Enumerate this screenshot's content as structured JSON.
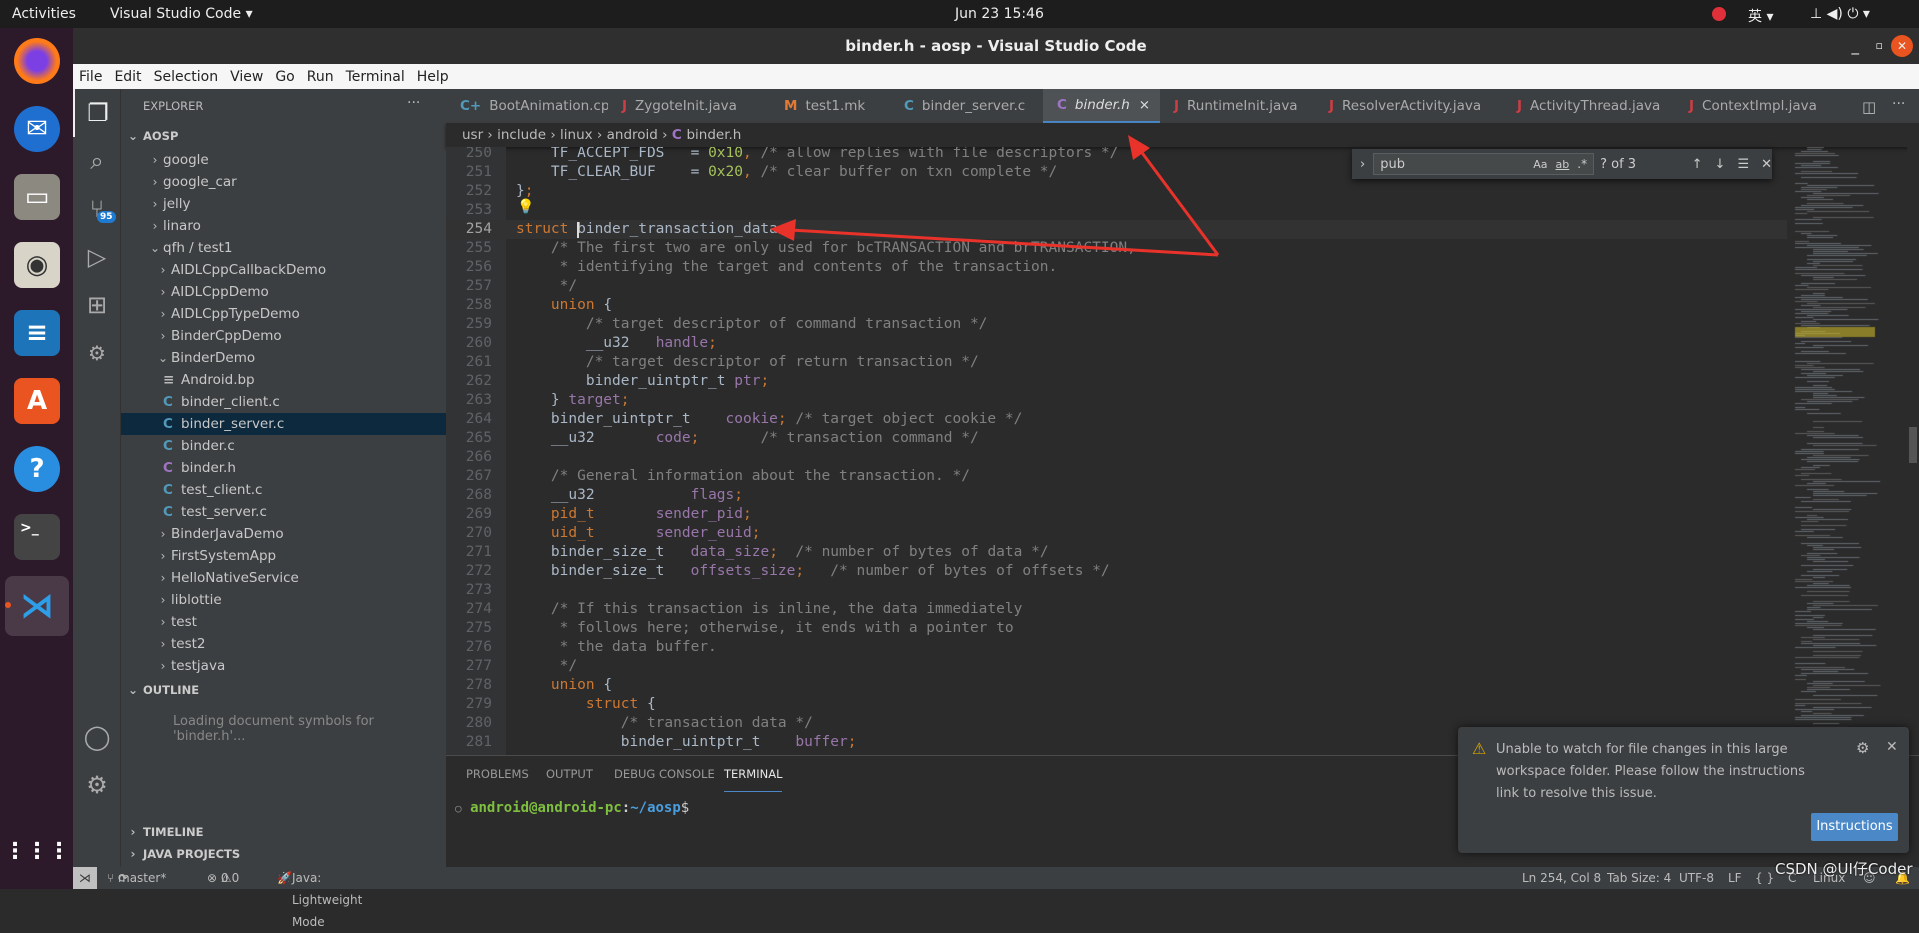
{
  "os": {
    "activities": "Activities",
    "app_menu": "Visual Studio Code ▾",
    "clock": "Jun 23  15:46",
    "input_method": "英 ▾"
  },
  "window": {
    "title": "binder.h - aosp - Visual Studio Code"
  },
  "menu": [
    "File",
    "Edit",
    "Selection",
    "View",
    "Go",
    "Run",
    "Terminal",
    "Help"
  ],
  "activity_bar": {
    "scm_badge": "95"
  },
  "sidebar": {
    "title": "EXPLORER",
    "more": "···",
    "root": "AOSP",
    "tree": [
      {
        "label": "google",
        "depth": 1,
        "type": "folder",
        "open": false
      },
      {
        "label": "google_car",
        "depth": 1,
        "type": "folder",
        "open": false
      },
      {
        "label": "jelly",
        "depth": 1,
        "type": "folder",
        "open": false
      },
      {
        "label": "linaro",
        "depth": 1,
        "type": "folder",
        "open": false
      },
      {
        "label": "qfh / test1",
        "depth": 1,
        "type": "folder",
        "open": true
      },
      {
        "label": "AIDLCppCallbackDemo",
        "depth": 2,
        "type": "folder",
        "open": false
      },
      {
        "label": "AIDLCppDemo",
        "depth": 2,
        "type": "folder",
        "open": false
      },
      {
        "label": "AIDLCppTypeDemo",
        "depth": 2,
        "type": "folder",
        "open": false
      },
      {
        "label": "BinderCppDemo",
        "depth": 2,
        "type": "folder",
        "open": false
      },
      {
        "label": "BinderDemo",
        "depth": 2,
        "type": "folder",
        "open": true
      },
      {
        "label": "Android.bp",
        "depth": 3,
        "type": "bp"
      },
      {
        "label": "binder_client.c",
        "depth": 3,
        "type": "c"
      },
      {
        "label": "binder_server.c",
        "depth": 3,
        "type": "c",
        "selected": true
      },
      {
        "label": "binder.c",
        "depth": 3,
        "type": "c"
      },
      {
        "label": "binder.h",
        "depth": 3,
        "type": "h"
      },
      {
        "label": "test_client.c",
        "depth": 3,
        "type": "c"
      },
      {
        "label": "test_server.c",
        "depth": 3,
        "type": "c"
      },
      {
        "label": "BinderJavaDemo",
        "depth": 2,
        "type": "folder",
        "open": false
      },
      {
        "label": "FirstSystemApp",
        "depth": 2,
        "type": "folder",
        "open": false
      },
      {
        "label": "HelloNativeService",
        "depth": 2,
        "type": "folder",
        "open": false
      },
      {
        "label": "liblottie",
        "depth": 2,
        "type": "folder",
        "open": false
      },
      {
        "label": "test",
        "depth": 2,
        "type": "folder",
        "open": false
      },
      {
        "label": "test2",
        "depth": 2,
        "type": "folder",
        "open": false
      },
      {
        "label": "testjava",
        "depth": 2,
        "type": "folder",
        "open": false
      }
    ],
    "outline": {
      "title": "OUTLINE",
      "message": "Loading document symbols for 'binder.h'..."
    },
    "timeline": "TIMELINE",
    "java_projects": "JAVA PROJECTS"
  },
  "tabs": [
    {
      "label": "BootAnimation.cpp",
      "icon": "C+",
      "color": "#519aba"
    },
    {
      "label": "ZygoteInit.java",
      "icon": "J",
      "color": "#cc3e44"
    },
    {
      "label": "test1.mk",
      "icon": "M",
      "color": "#e37933"
    },
    {
      "label": "binder_server.c",
      "icon": "C",
      "color": "#519aba"
    },
    {
      "label": "binder.h",
      "icon": "C",
      "color": "#a074c4",
      "active": true
    },
    {
      "label": "RuntimeInit.java",
      "icon": "J",
      "color": "#cc3e44"
    },
    {
      "label": "ResolverActivity.java",
      "icon": "J",
      "color": "#cc3e44"
    },
    {
      "label": "ActivityThread.java",
      "icon": "J",
      "color": "#cc3e44"
    },
    {
      "label": "ContextImpl.java",
      "icon": "J",
      "color": "#cc3e44"
    }
  ],
  "tab_close": "×",
  "breadcrumb": [
    "usr",
    "include",
    "linux",
    "android",
    "binder.h"
  ],
  "find": {
    "query": "pub",
    "match_case": "Aa",
    "whole_word": "ab",
    "regex": ".*",
    "result": "? of 3"
  },
  "editor": {
    "current_line": 254,
    "lines": [
      {
        "n": 250,
        "t": [
          [
            "    TF_ACCEPT_FDS   = ",
            "pl"
          ],
          [
            "0x10",
            "nm"
          ],
          [
            ", ",
            "kw"
          ],
          [
            "/* allow replies with file descriptors */",
            "cm"
          ]
        ]
      },
      {
        "n": 251,
        "t": [
          [
            "    TF_CLEAR_BUF    = ",
            "pl"
          ],
          [
            "0x20",
            "nm"
          ],
          [
            ", ",
            "kw"
          ],
          [
            "/* clear buffer on txn complete */",
            "cm"
          ]
        ]
      },
      {
        "n": 252,
        "t": [
          [
            "}",
            "pl"
          ],
          [
            ";",
            "kw"
          ]
        ]
      },
      {
        "n": 253,
        "t": []
      },
      {
        "n": 254,
        "t": [
          [
            "struct ",
            "kw"
          ],
          [
            "binder_transaction_data {",
            "pl"
          ]
        ]
      },
      {
        "n": 255,
        "t": [
          [
            "    /* The first two are only used for bcTRANSACTION and brTRANSACTION,",
            "cm"
          ]
        ]
      },
      {
        "n": 256,
        "t": [
          [
            "     * identifying the target and contents of the transaction.",
            "cm"
          ]
        ]
      },
      {
        "n": 257,
        "t": [
          [
            "     */",
            "cm"
          ]
        ]
      },
      {
        "n": 258,
        "t": [
          [
            "    union ",
            "kw"
          ],
          [
            "{",
            "pl"
          ]
        ]
      },
      {
        "n": 259,
        "t": [
          [
            "        /* target descriptor of command transaction */",
            "cm"
          ]
        ]
      },
      {
        "n": 260,
        "t": [
          [
            "        __u32   ",
            "pl"
          ],
          [
            "handle",
            "fd"
          ],
          [
            ";",
            "kw"
          ]
        ]
      },
      {
        "n": 261,
        "t": [
          [
            "        /* target descriptor of return transaction */",
            "cm"
          ]
        ]
      },
      {
        "n": 262,
        "t": [
          [
            "        binder_uintptr_t ",
            "pl"
          ],
          [
            "ptr",
            "fd"
          ],
          [
            ";",
            "kw"
          ]
        ]
      },
      {
        "n": 263,
        "t": [
          [
            "    } ",
            "pl"
          ],
          [
            "target",
            "fd"
          ],
          [
            ";",
            "kw"
          ]
        ]
      },
      {
        "n": 264,
        "t": [
          [
            "    binder_uintptr_t    ",
            "pl"
          ],
          [
            "cookie",
            "fd"
          ],
          [
            "; ",
            "kw"
          ],
          [
            "/* target object cookie */",
            "cm"
          ]
        ]
      },
      {
        "n": 265,
        "t": [
          [
            "    __u32       ",
            "pl"
          ],
          [
            "code",
            "fd"
          ],
          [
            ";",
            "kw"
          ],
          [
            "       /* transaction command */",
            "cm"
          ]
        ]
      },
      {
        "n": 266,
        "t": []
      },
      {
        "n": 267,
        "t": [
          [
            "    /* General information about the transaction. */",
            "cm"
          ]
        ]
      },
      {
        "n": 268,
        "t": [
          [
            "    __u32           ",
            "pl"
          ],
          [
            "flags",
            "fd"
          ],
          [
            ";",
            "kw"
          ]
        ]
      },
      {
        "n": 269,
        "t": [
          [
            "    pid_t       ",
            "kw"
          ],
          [
            "sender_pid",
            "fd"
          ],
          [
            ";",
            "kw"
          ]
        ]
      },
      {
        "n": 270,
        "t": [
          [
            "    uid_t       ",
            "kw"
          ],
          [
            "sender_euid",
            "fd"
          ],
          [
            ";",
            "kw"
          ]
        ]
      },
      {
        "n": 271,
        "t": [
          [
            "    binder_size_t   ",
            "pl"
          ],
          [
            "data_size",
            "fd"
          ],
          [
            ";  ",
            "kw"
          ],
          [
            "/* number of bytes of data */",
            "cm"
          ]
        ]
      },
      {
        "n": 272,
        "t": [
          [
            "    binder_size_t   ",
            "pl"
          ],
          [
            "offsets_size",
            "fd"
          ],
          [
            ";   ",
            "kw"
          ],
          [
            "/* number of bytes of offsets */",
            "cm"
          ]
        ]
      },
      {
        "n": 273,
        "t": []
      },
      {
        "n": 274,
        "t": [
          [
            "    /* If this transaction is inline, the data immediately",
            "cm"
          ]
        ]
      },
      {
        "n": 275,
        "t": [
          [
            "     * follows here; otherwise, it ends with a pointer to",
            "cm"
          ]
        ]
      },
      {
        "n": 276,
        "t": [
          [
            "     * the data buffer.",
            "cm"
          ]
        ]
      },
      {
        "n": 277,
        "t": [
          [
            "     */",
            "cm"
          ]
        ]
      },
      {
        "n": 278,
        "t": [
          [
            "    union ",
            "kw"
          ],
          [
            "{",
            "pl"
          ]
        ]
      },
      {
        "n": 279,
        "t": [
          [
            "        struct ",
            "kw"
          ],
          [
            "{",
            "pl"
          ]
        ]
      },
      {
        "n": 280,
        "t": [
          [
            "            /* transaction data */",
            "cm"
          ]
        ]
      },
      {
        "n": 281,
        "t": [
          [
            "            binder_uintptr_t    ",
            "pl"
          ],
          [
            "buffer",
            "fd"
          ],
          [
            ";",
            "kw"
          ]
        ]
      }
    ]
  },
  "panel": {
    "tabs": [
      "PROBLEMS",
      "OUTPUT",
      "DEBUG CONSOLE",
      "TERMINAL"
    ],
    "active": "TERMINAL",
    "terminal": {
      "user_host": "android@android-pc",
      "sep": ":",
      "path": "~/aosp",
      "prompt": "$"
    }
  },
  "notification": {
    "message": "Unable to watch for file changes in this large workspace folder. Please follow the instructions link to resolve this issue.",
    "button": "Instructions"
  },
  "status": {
    "branch": "master*",
    "errors": "0",
    "warnings": "0",
    "java": "Java: Lightweight Mode",
    "position": "Ln 254, Col 8",
    "tab_size": "Tab Size: 4",
    "encoding": "UTF-8",
    "eol": "LF",
    "language": "C",
    "platform": "Linux"
  },
  "watermark": "CSDN @UI仔Coder",
  "colors": {
    "accent": "#4a88c7",
    "annotation_arrow": "#e8322a",
    "button": "#4a88c7"
  }
}
